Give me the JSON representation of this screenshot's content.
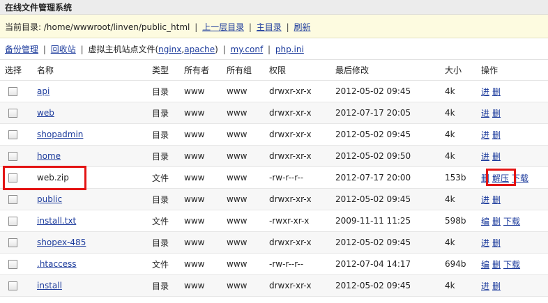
{
  "header": {
    "title": "在线文件管理系统"
  },
  "path": {
    "label": "当前目录: /home/wwwroot/linven/public_html",
    "links": [
      "上一层目录",
      "主目录",
      "刷新"
    ]
  },
  "toolbar": {
    "backup": "备份管理",
    "recycle": "回收站",
    "vhost_text": "虚拟主机站点文件(",
    "nginx": "nginx",
    "comma": ",",
    "apache": "apache",
    "vhost_end": ")",
    "myconf": "my.conf",
    "phpini": "php.ini"
  },
  "table": {
    "columns": [
      "选择",
      "名称",
      "类型",
      "所有者",
      "所有组",
      "权限",
      "最后修改",
      "大小",
      "操作"
    ],
    "rows": [
      {
        "name": "api",
        "type": "目录",
        "owner": "www",
        "group": "www",
        "perm": "drwxr-xr-x",
        "mtime": "2012-05-02 09:45",
        "size": "4k",
        "ops": [
          "进",
          "删"
        ]
      },
      {
        "name": "web",
        "type": "目录",
        "owner": "www",
        "group": "www",
        "perm": "drwxr-xr-x",
        "mtime": "2012-07-17 20:05",
        "size": "4k",
        "ops": [
          "进",
          "删"
        ]
      },
      {
        "name": "shopadmin",
        "type": "目录",
        "owner": "www",
        "group": "www",
        "perm": "drwxr-xr-x",
        "mtime": "2012-05-02 09:45",
        "size": "4k",
        "ops": [
          "进",
          "删"
        ]
      },
      {
        "name": "home",
        "type": "目录",
        "owner": "www",
        "group": "www",
        "perm": "drwxr-xr-x",
        "mtime": "2012-05-02 09:50",
        "size": "4k",
        "ops": [
          "进",
          "删"
        ]
      },
      {
        "name": "web.zip",
        "type": "文件",
        "owner": "www",
        "group": "www",
        "perm": "-rw-r--r--",
        "mtime": "2012-07-17 20:00",
        "size": "153b",
        "ops": [
          "删",
          "解压",
          "下载"
        ]
      },
      {
        "name": "public",
        "type": "目录",
        "owner": "www",
        "group": "www",
        "perm": "drwxr-xr-x",
        "mtime": "2012-05-02 09:45",
        "size": "4k",
        "ops": [
          "进",
          "删"
        ]
      },
      {
        "name": "install.txt",
        "type": "文件",
        "owner": "www",
        "group": "www",
        "perm": "-rwxr-xr-x",
        "mtime": "2009-11-11 11:25",
        "size": "598b",
        "ops": [
          "编",
          "删",
          "下载"
        ]
      },
      {
        "name": "shopex-485",
        "type": "目录",
        "owner": "www",
        "group": "www",
        "perm": "drwxr-xr-x",
        "mtime": "2012-05-02 09:45",
        "size": "4k",
        "ops": [
          "进",
          "删"
        ]
      },
      {
        "name": ".htaccess",
        "type": "文件",
        "owner": "www",
        "group": "www",
        "perm": "-rw-r--r--",
        "mtime": "2012-07-04 14:17",
        "size": "694b",
        "ops": [
          "编",
          "删",
          "下载"
        ]
      },
      {
        "name": "install",
        "type": "目录",
        "owner": "www",
        "group": "www",
        "perm": "drwxr-xr-x",
        "mtime": "2012-05-02 09:45",
        "size": "4k",
        "ops": [
          "进",
          "删"
        ]
      }
    ]
  },
  "highlight_color": "#e31414"
}
